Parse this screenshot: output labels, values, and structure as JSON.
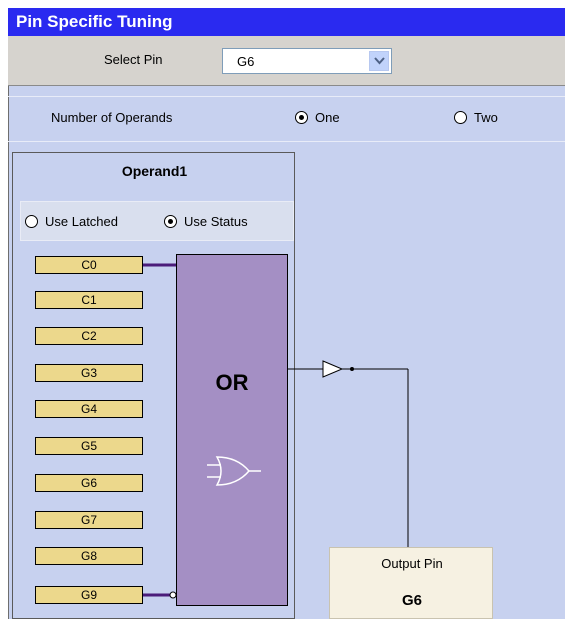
{
  "title": "Pin Specific Tuning",
  "select_pin": {
    "label": "Select Pin",
    "value": "G6"
  },
  "operands": {
    "label": "Number of Operands",
    "options": [
      {
        "label": "One",
        "checked": true
      },
      {
        "label": "Two",
        "checked": false
      }
    ]
  },
  "operand1": {
    "title": "Operand1",
    "modes": [
      {
        "label": "Use Latched",
        "checked": false
      },
      {
        "label": "Use Status",
        "checked": true
      }
    ],
    "pins": [
      "C0",
      "C1",
      "C2",
      "G3",
      "G4",
      "G5",
      "G6",
      "G7",
      "G8",
      "G9"
    ]
  },
  "gate": {
    "label": "OR",
    "icon": "or-gate-icon"
  },
  "output": {
    "label": "Output Pin",
    "value": "G6"
  },
  "colors": {
    "title_bar": "#2a2af0",
    "panel": "#c7d1ef",
    "gate": "#a48fc4",
    "pin_label": "#ecd88c",
    "wire_active": "#4b1c7a"
  }
}
